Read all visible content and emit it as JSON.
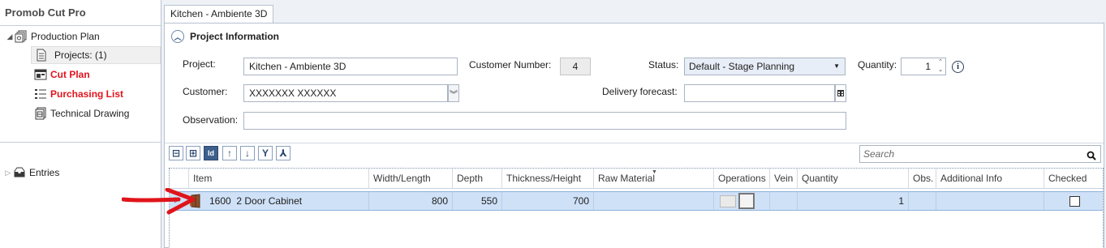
{
  "app": {
    "title": "Promob Cut Pro"
  },
  "tree": {
    "production_plan": "Production Plan",
    "projects": "Projects: (1)",
    "cut_plan": "Cut Plan",
    "purchasing_list": "Purchasing List",
    "technical_drawing": "Technical Drawing",
    "entries": "Entries"
  },
  "tab": {
    "label": "Kitchen - Ambiente 3D"
  },
  "project_info": {
    "title": "Project Information",
    "project_label": "Project:",
    "project_value": "Kitchen - Ambiente 3D",
    "customer_number_label": "Customer Number:",
    "customer_number_value": "4",
    "status_label": "Status:",
    "status_value": "Default - Stage Planning",
    "quantity_label": "Quantity:",
    "quantity_value": "1",
    "customer_label": "Customer:",
    "customer_value": "XXXXXXX XXXXXX",
    "delivery_label": "Delivery forecast:",
    "delivery_value": "",
    "observation_label": "Observation:",
    "observation_value": ""
  },
  "search": {
    "placeholder": "Search"
  },
  "grid": {
    "columns": [
      "Item",
      "Width/Length",
      "Depth",
      "Thickness/Height",
      "Raw Material",
      "Operations",
      "Vein",
      "Quantity",
      "Obs.",
      "Additional Info",
      "Checked"
    ],
    "rows": [
      {
        "code": "1600",
        "name": "2 Door Cabinet",
        "width": "800",
        "depth": "550",
        "thickness": "700",
        "raw_material": "",
        "vein": "",
        "quantity": "1",
        "obs": "",
        "additional_info": "",
        "checked": false
      }
    ]
  },
  "colors": {
    "highlight_red": "#e1141d",
    "row_selected": "#cfe1f7",
    "accent": "#3d5f8c"
  }
}
